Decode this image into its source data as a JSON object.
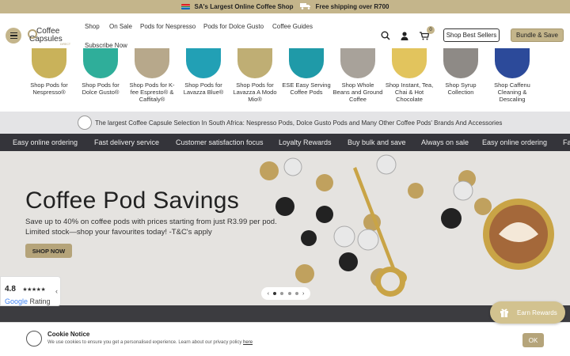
{
  "topbar": {
    "left_text": "SA's Largest Online Coffee Shop",
    "right_text": "Free shipping over R700"
  },
  "header": {
    "logo_main": "Coffee",
    "logo_sub": "Capsules",
    "logo_direct": "DIRECT",
    "nav": [
      "Shop",
      "On Sale",
      "Pods for Nespresso",
      "Pods for Dolce Gusto",
      "Coffee Guides",
      "Subscribe Now"
    ],
    "cart_count": "0",
    "best_sellers_label": "Shop Best Sellers",
    "bundle_label": "Bundle & Save"
  },
  "categories": [
    {
      "label": "Shop Pods for Nespresso®",
      "color": "#c9b25a"
    },
    {
      "label": "Shop Pods for Dolce Gusto®",
      "color": "#2fae9a"
    },
    {
      "label": "Shop Pods for K-fee Espresto® & Caffitaly®",
      "color": "#b7a88b"
    },
    {
      "label": "Shop Pods for Lavazza Blue®",
      "color": "#22a0b5"
    },
    {
      "label": "Shop Pods for Lavazza A Modo Mio®",
      "color": "#bfae74"
    },
    {
      "label": "ESE Easy Serving Coffee Pods",
      "color": "#1f9aa8"
    },
    {
      "label": "Shop Whole Beans and Ground Coffee",
      "color": "#a8a29a"
    },
    {
      "label": "Shop Instant, Tea, Chai & Hot Chocolate",
      "color": "#e2c45d"
    },
    {
      "label": "Shop Syrup Collection",
      "color": "#8e8a86"
    },
    {
      "label": "Shop Caffenu Cleaning & Descaling",
      "color": "#2c4a9a"
    }
  ],
  "info_strip": "The largest Coffee Capsule Selection In South Africa: Nespresso Pods, Dolce Gusto Pods and Many Other Coffee Pods' Brands And Accessories",
  "ticker": [
    "Easy online ordering",
    "Fast delivery service",
    "Customer satisfaction focus",
    "Loyalty Rewards",
    "Buy bulk and save",
    "Always on sale",
    "Easy online ordering",
    "Fa"
  ],
  "hero": {
    "title": "Coffee Pod Savings",
    "text": "Save up to 40% on coffee pods with prices starting from just R3.99 per pod. Limited stock—shop your favourites today! -T&C's apply",
    "cta": "SHOP NOW"
  },
  "rating": {
    "score": "4.8",
    "stars": "★★★★★",
    "source_google": "Google",
    "source_rating": "Rating"
  },
  "rewards_label": "Earn Rewards",
  "cookie": {
    "title": "Cookie Notice",
    "text": "We use cookies to ensure you get a personalised experience. Learn about our privacy policy ",
    "link": "here",
    "ok": "OK"
  },
  "colors": {
    "brand_gold": "#c4b58b",
    "dark_band": "#34343a"
  }
}
